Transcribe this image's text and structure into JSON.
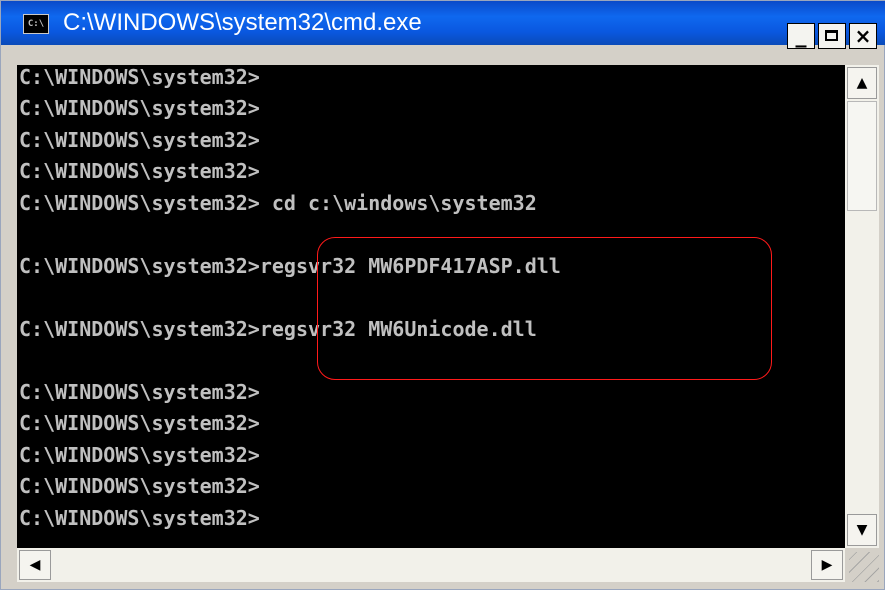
{
  "window": {
    "title": "C:\\WINDOWS\\system32\\cmd.exe",
    "icon_text": "C:\\",
    "icon": "cmd-icon",
    "buttons": {
      "minimize": "_",
      "close": "×"
    }
  },
  "console": {
    "lines": [
      "C:\\WINDOWS\\system32>",
      "C:\\WINDOWS\\system32>",
      "C:\\WINDOWS\\system32>",
      "C:\\WINDOWS\\system32>",
      "C:\\WINDOWS\\system32> cd c:\\windows\\system32",
      "",
      "C:\\WINDOWS\\system32>regsvr32 MW6PDF417ASP.dll",
      "",
      "C:\\WINDOWS\\system32>regsvr32 MW6Unicode.dll",
      "",
      "C:\\WINDOWS\\system32>",
      "C:\\WINDOWS\\system32>",
      "C:\\WINDOWS\\system32>",
      "C:\\WINDOWS\\system32>",
      "C:\\WINDOWS\\system32>"
    ]
  },
  "scrollbars": {
    "up": "▲",
    "down": "▼",
    "left": "◀",
    "right": "▶"
  },
  "colors": {
    "console_bg": "#000000",
    "console_fg": "#c0c0c0",
    "titlebar": "#0a58e0",
    "highlight": "#ff1a1a"
  }
}
